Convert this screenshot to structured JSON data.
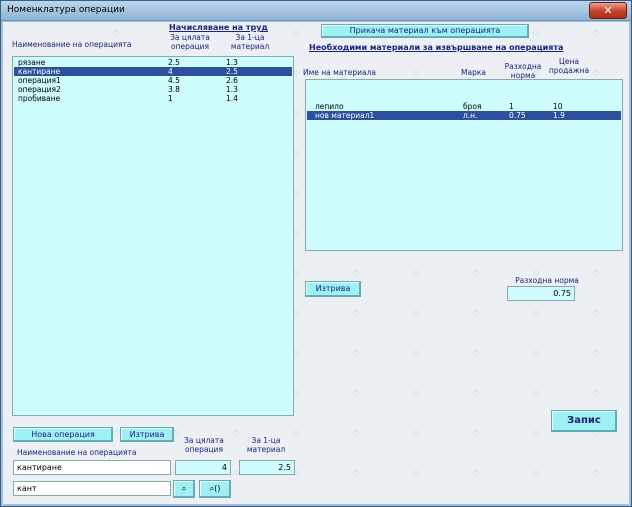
{
  "window": {
    "title": "Номенклатура операции",
    "close_glyph": "✕"
  },
  "labor": {
    "header": "Начисляване на труд",
    "col_name": "Наименование на операцията",
    "col_whole": "За цялата операция",
    "col_unit": "За 1-ца материал",
    "rows": [
      {
        "name": "рязане",
        "whole": "2.5",
        "unit": "1.3",
        "selected": false
      },
      {
        "name": "кантиране",
        "whole": "4",
        "unit": "2.5",
        "selected": true
      },
      {
        "name": "операция1",
        "whole": "4.5",
        "unit": "2.6",
        "selected": false
      },
      {
        "name": "операция2",
        "whole": "3.8",
        "unit": "1.3",
        "selected": false
      },
      {
        "name": "пробиване",
        "whole": "1",
        "unit": "1.4",
        "selected": false
      }
    ]
  },
  "materials": {
    "attach_button": "Прикача материал към операцията",
    "header": "Необходими материали за извършване на операцията",
    "col_name": "Име на материала",
    "col_unit": "Марка",
    "col_norm": "Разходна норма",
    "col_price": "Цена продажна",
    "rows": [
      {
        "name": "лепило",
        "unit": "броя",
        "norm": "1",
        "price": "10",
        "selected": false
      },
      {
        "name": "нов материал1",
        "unit": "л.н.",
        "norm": "0.75",
        "price": "1.9",
        "selected": true
      }
    ],
    "delete_button": "Изтрива",
    "norm_label": "Разходна норма",
    "norm_value": "0.75",
    "save_button": "Запис"
  },
  "editor": {
    "new_button": "Нова операция",
    "delete_button": "Изтрива",
    "name_label": "Наименование на операцията",
    "whole_label": "За цялата операция",
    "unit_label": "За 1-ца материал",
    "name_value": "кантиране",
    "whole_value": "4",
    "unit_value": "2.5",
    "search_value": "кант",
    "search_btn1": "⌕",
    "search_btn2": "⌕()"
  }
}
